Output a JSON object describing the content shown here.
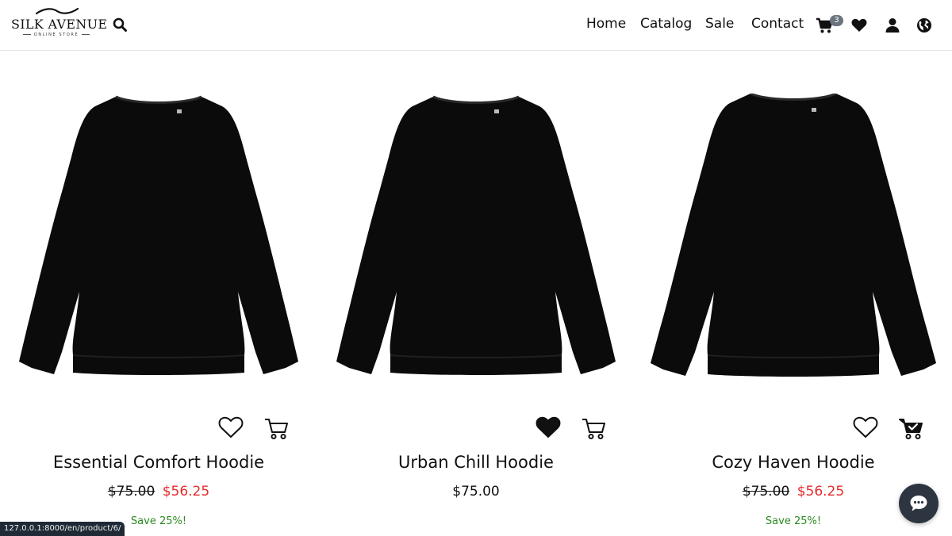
{
  "header": {
    "logo": {
      "brand": "SILK AVENUE",
      "tagline": "ONLINE STORE"
    },
    "search_icon": "search-icon",
    "nav": [
      {
        "label": "Home"
      },
      {
        "label": "Catalog"
      },
      {
        "label": "Sale"
      },
      {
        "label": "Contact"
      }
    ],
    "cart_count": "3",
    "icons": [
      "cart-icon",
      "heart-icon",
      "user-icon",
      "globe-icon"
    ]
  },
  "products": [
    {
      "name": "Essential Comfort Hoodie",
      "old_price": "$75.00",
      "price": "$56.25",
      "save": "Save 25%!",
      "wishlisted": false,
      "in_cart": false
    },
    {
      "name": "Urban Chill Hoodie",
      "price": "$75.00",
      "wishlisted": true,
      "in_cart": false
    },
    {
      "name": "Cozy Haven Hoodie",
      "old_price": "$75.00",
      "price": "$56.25",
      "save": "Save 25%!",
      "wishlisted": false,
      "in_cart": true
    }
  ],
  "status_url": "127.0.0.1:8000/en/product/6/",
  "colors": {
    "sale_price": "#e52d2d",
    "save_note": "#2a8a1f",
    "badge": "#6c757d",
    "chat": "#2d3640"
  }
}
